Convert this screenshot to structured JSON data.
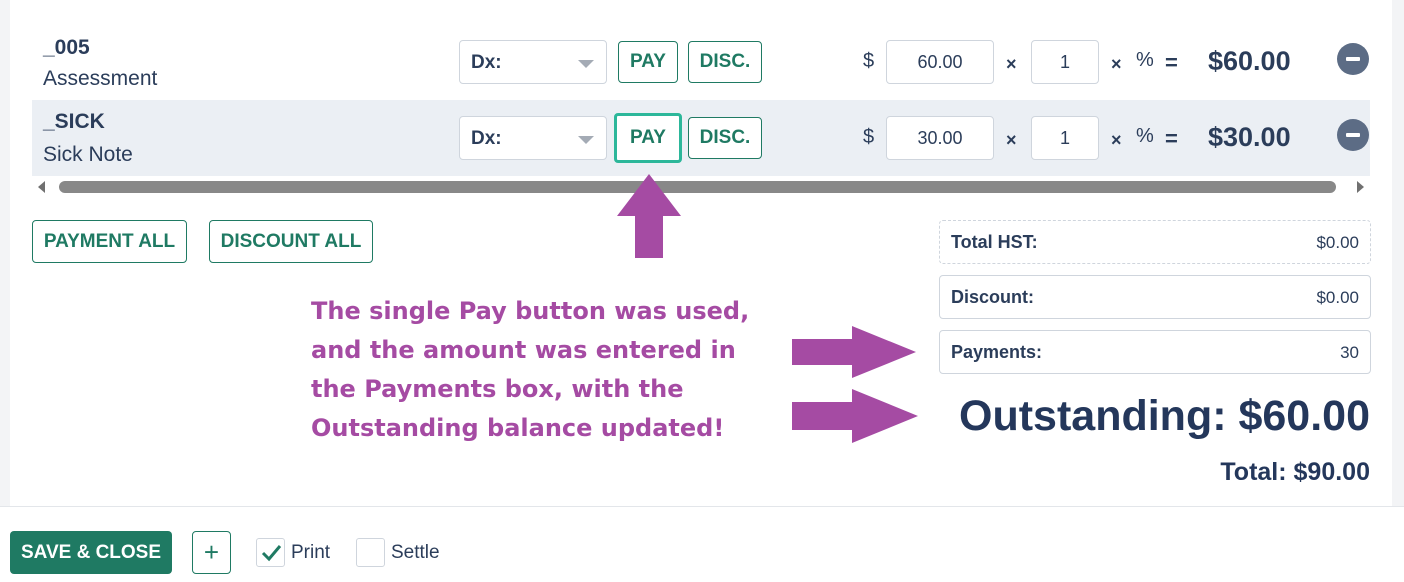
{
  "line_items": [
    {
      "code": "_005",
      "description": "Assessment",
      "dx_label": "Dx:",
      "pay_label": "PAY",
      "disc_label": "DISC.",
      "currency": "$",
      "price": "60.00",
      "times": "×",
      "quantity": "1",
      "percent": "%",
      "equals": "=",
      "total": "$60.00"
    },
    {
      "code": "_SICK",
      "description": "Sick Note",
      "dx_label": "Dx:",
      "pay_label": "PAY",
      "disc_label": "DISC.",
      "currency": "$",
      "price": "30.00",
      "times": "×",
      "quantity": "1",
      "percent": "%",
      "equals": "=",
      "total": "$30.00"
    }
  ],
  "actions": {
    "payment_all": "PAYMENT ALL",
    "discount_all": "DISCOUNT ALL"
  },
  "summary": {
    "hst_label": "Total HST:",
    "hst_value": "$0.00",
    "discount_label": "Discount:",
    "discount_value": "$0.00",
    "payments_label": "Payments:",
    "payments_value": "30",
    "outstanding": "Outstanding: $60.00",
    "total": "Total: $90.00"
  },
  "annotation": {
    "lines": [
      "The single Pay button was used,",
      "and the amount was entered in",
      "the Payments box, with the",
      "Outstanding balance updated!"
    ],
    "color": "#a54ba3"
  },
  "footer": {
    "save_close": "SAVE & CLOSE",
    "add": "+",
    "print_label": "Print",
    "print_checked": true,
    "settle_label": "Settle",
    "settle_checked": false
  },
  "colors": {
    "accent": "#1f7a63",
    "focus": "#2cb79a",
    "text": "#2b3d5a"
  }
}
